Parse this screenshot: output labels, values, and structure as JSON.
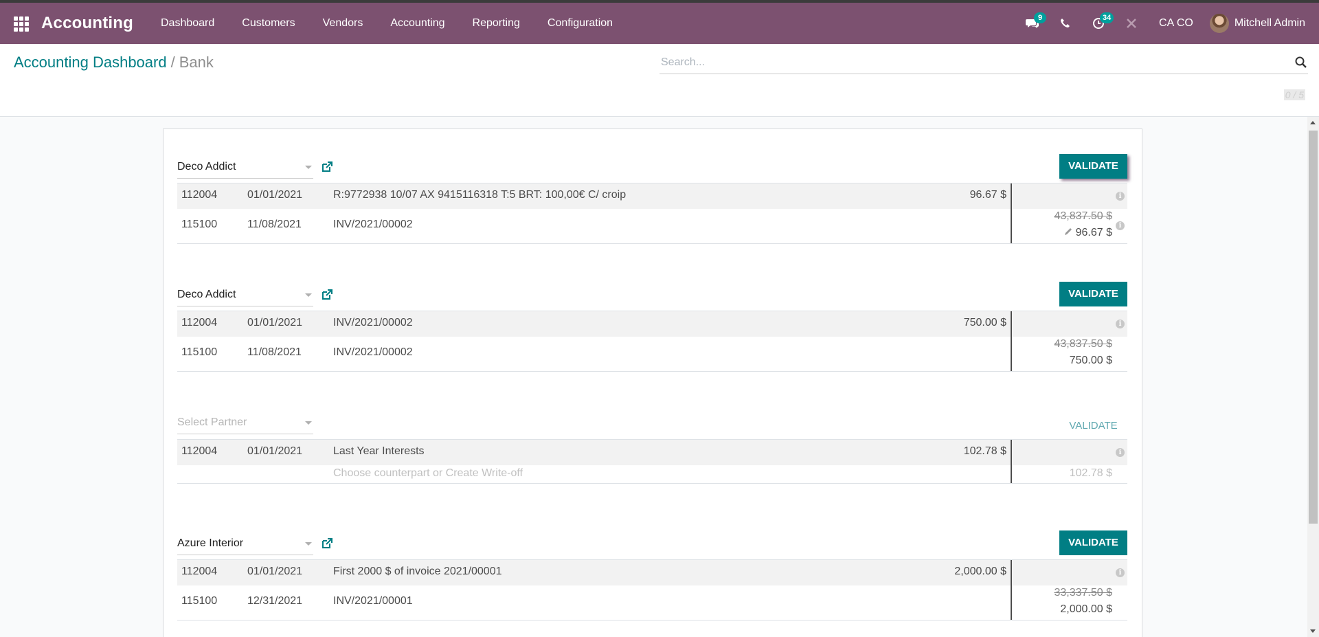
{
  "navbar": {
    "brand": "Accounting",
    "menu": [
      "Dashboard",
      "Customers",
      "Vendors",
      "Accounting",
      "Reporting",
      "Configuration"
    ],
    "messages_badge": "9",
    "activities_badge": "34",
    "company": "CA CO",
    "user": "Mitchell Admin"
  },
  "control": {
    "breadcrumb_parent": "Accounting Dashboard",
    "breadcrumb_separator": "/",
    "breadcrumb_current": "Bank",
    "search_placeholder": "Search...",
    "pager": "0 / 5"
  },
  "lines": [
    {
      "partner": "Deco Addict",
      "validate": "VALIDATE",
      "statement": {
        "account": "112004",
        "date": "01/01/2021",
        "label": "R:9772938 10/07 AX 9415116318 T:5 BRT: 100,00€ C/ croip",
        "amount": "96.67 $"
      },
      "counterpart": {
        "account": "115100",
        "date": "11/08/2021",
        "label": "INV/2021/00002",
        "original": "43,837.50 $",
        "amount": "96.67 $"
      }
    },
    {
      "partner": "Deco Addict",
      "validate": "VALIDATE",
      "statement": {
        "account": "112004",
        "date": "01/01/2021",
        "label": "INV/2021/00002",
        "amount": "750.00 $"
      },
      "counterpart": {
        "account": "115100",
        "date": "11/08/2021",
        "label": "INV/2021/00002",
        "original": "43,837.50 $",
        "amount": "750.00 $"
      }
    },
    {
      "partner_placeholder": "Select Partner",
      "validate": "VALIDATE",
      "statement": {
        "account": "112004",
        "date": "01/01/2021",
        "label": "Last Year Interests",
        "amount": "102.78 $"
      },
      "hint": {
        "label": "Choose counterpart or Create Write-off",
        "amount": "102.78 $"
      }
    },
    {
      "partner": "Azure Interior",
      "validate": "VALIDATE",
      "statement": {
        "account": "112004",
        "date": "01/01/2021",
        "label": "First 2000 $ of invoice 2021/00001",
        "amount": "2,000.00 $"
      },
      "counterpart": {
        "account": "115100",
        "date": "12/31/2021",
        "label": "INV/2021/00001",
        "original": "33,337.50 $",
        "amount": "2,000.00 $"
      }
    }
  ],
  "info_icon_glyph": "i",
  "colors": {
    "navbar": "#7c5170",
    "primary": "#017e84",
    "link": "#017e84"
  }
}
